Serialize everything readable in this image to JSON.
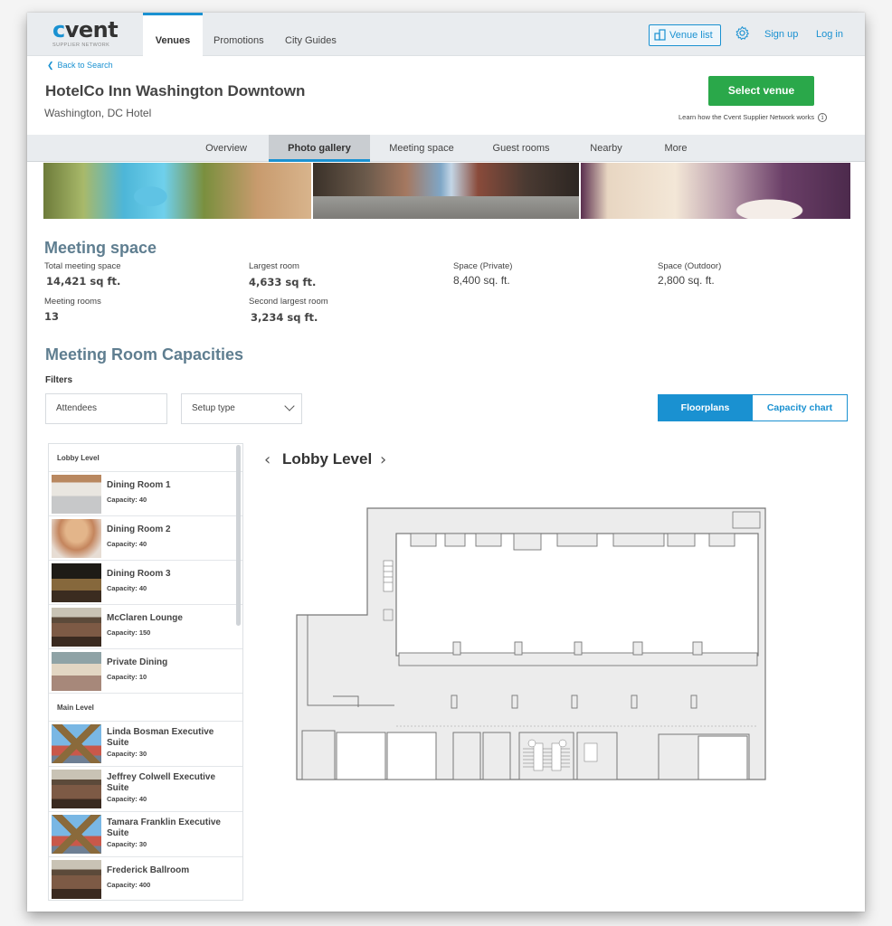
{
  "brand": {
    "name": "cvent",
    "subtitle": "SUPPLIER NETWORK",
    "accent": "#1a91d1",
    "cta": "#2aa84a"
  },
  "topnav": {
    "tabs": [
      {
        "label": "Venues",
        "active": true
      },
      {
        "label": "Promotions",
        "active": false
      },
      {
        "label": "City Guides",
        "active": false
      }
    ],
    "venue_list": "Venue list",
    "settings_icon": "gear-icon",
    "sign_up": "Sign up",
    "log_in": "Log in"
  },
  "header": {
    "back": "Back to Search",
    "title": "HotelCo Inn Washington Downtown",
    "subtitle": "Washington, DC Hotel",
    "select_venue": "Select venue",
    "learn": "Learn how the Cvent Supplier Network works",
    "info_icon": "i"
  },
  "section_tabs": [
    {
      "label": "Overview",
      "active": false
    },
    {
      "label": "Photo gallery",
      "active": true
    },
    {
      "label": "Meeting space",
      "active": false
    },
    {
      "label": "Guest rooms",
      "active": false
    },
    {
      "label": "Nearby",
      "active": false
    },
    {
      "label": "More",
      "active": false
    }
  ],
  "gallery": [
    "pool",
    "street",
    "guest-room"
  ],
  "meeting_space": {
    "heading": "Meeting space",
    "stats": [
      {
        "label": "Total meeting space",
        "value": "14,421 sq ft."
      },
      {
        "label": "Largest room",
        "value": "4,633 sq ft."
      },
      {
        "label": "Space (Private)",
        "value": "8,400 sq. ft."
      },
      {
        "label": "Space (Outdoor)",
        "value": "2,800 sq. ft."
      },
      {
        "label": "Meeting rooms",
        "value": "13"
      },
      {
        "label": "Second largest room",
        "value": "3,234 sq ft."
      }
    ]
  },
  "capacities": {
    "heading": "Meeting Room Capacities",
    "filters_label": "Filters",
    "attendees_placeholder": "Attendees",
    "setup_type": "Setup type",
    "view_toggle": [
      {
        "label": "Floorplans",
        "active": true
      },
      {
        "label": "Capacity chart",
        "active": false
      }
    ]
  },
  "room_list": {
    "levels": [
      {
        "name": "Lobby Level",
        "rooms": [
          {
            "name": "Dining Room 1",
            "capacity": "Capacity: 40"
          },
          {
            "name": "Dining Room 2",
            "capacity": "Capacity: 40"
          },
          {
            "name": "Dining Room 3",
            "capacity": "Capacity: 40"
          },
          {
            "name": "McClaren Lounge",
            "capacity": "Capacity: 150"
          },
          {
            "name": "Private Dining",
            "capacity": "Capacity: 10"
          }
        ]
      },
      {
        "name": "Main Level",
        "rooms": [
          {
            "name": "Linda Bosman Executive Suite",
            "capacity": "Capacity: 30"
          },
          {
            "name": "Jeffrey Colwell Executive Suite",
            "capacity": "Capacity: 40"
          },
          {
            "name": "Tamara Franklin Executive Suite",
            "capacity": "Capacity: 30"
          },
          {
            "name": "Frederick Ballroom",
            "capacity": "Capacity: 400"
          }
        ]
      }
    ]
  },
  "floorplan": {
    "level": "Lobby Level",
    "prev": "‹",
    "next": "›"
  }
}
